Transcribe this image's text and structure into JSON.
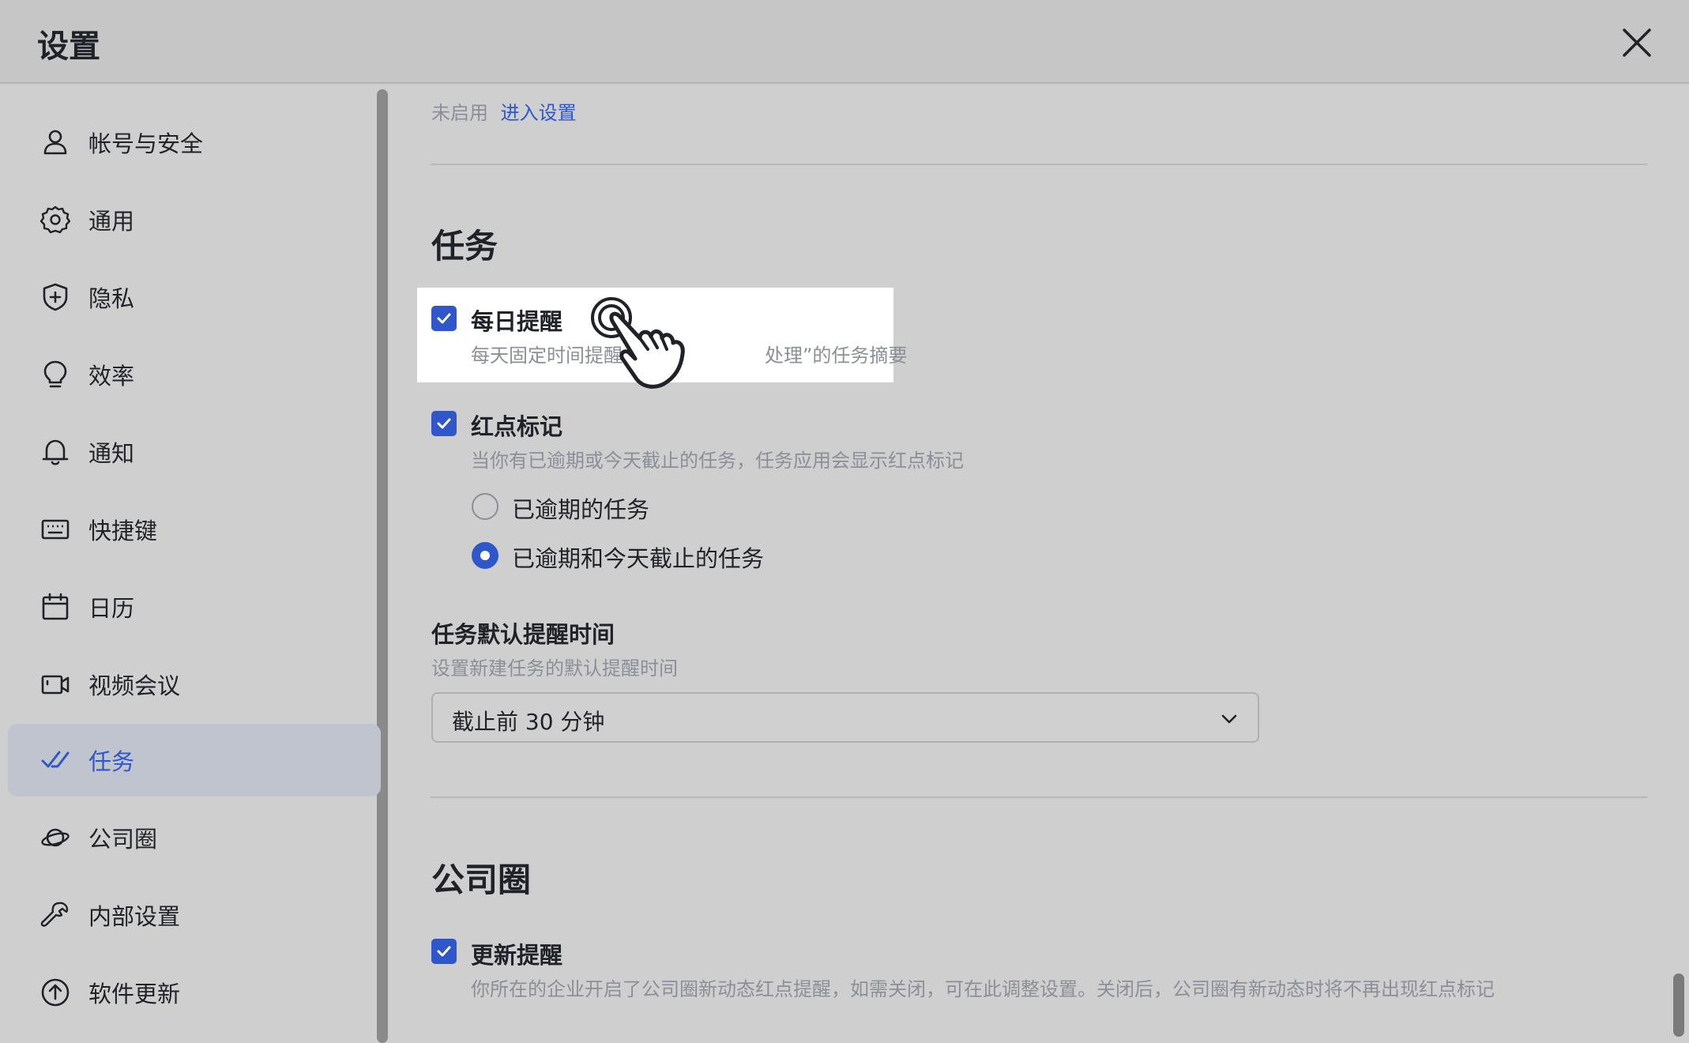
{
  "window": {
    "title": "设置",
    "close_icon": "close-icon"
  },
  "sidebar": {
    "items": [
      {
        "label": "帐号与安全",
        "icon": "user-icon"
      },
      {
        "label": "通用",
        "icon": "gear-icon"
      },
      {
        "label": "隐私",
        "icon": "shield-icon"
      },
      {
        "label": "效率",
        "icon": "lightbulb-icon"
      },
      {
        "label": "通知",
        "icon": "bell-icon"
      },
      {
        "label": "快捷键",
        "icon": "keyboard-icon"
      },
      {
        "label": "日历",
        "icon": "calendar-icon"
      },
      {
        "label": "视频会议",
        "icon": "video-icon"
      },
      {
        "label": "任务",
        "icon": "task-check-icon",
        "active": true
      },
      {
        "label": "公司圈",
        "icon": "planet-icon"
      },
      {
        "label": "内部设置",
        "icon": "wrench-icon"
      },
      {
        "label": "软件更新",
        "icon": "upload-circle-icon"
      }
    ]
  },
  "content": {
    "top_status": "未启用",
    "top_link": "进入设置",
    "task_section": {
      "title": "任务",
      "daily_reminder": {
        "label": "每日提醒",
        "desc_before": "每天固定时间提醒",
        "desc_after": "处理”的任务摘要",
        "checked": true
      },
      "red_dot": {
        "label": "红点标记",
        "desc": "当你有已逾期或今天截止的任务，任务应用会显示红点标记",
        "checked": true,
        "options": [
          {
            "label": "已逾期的任务",
            "selected": false
          },
          {
            "label": "已逾期和今天截止的任务",
            "selected": true
          }
        ]
      },
      "default_time": {
        "label": "任务默认提醒时间",
        "desc": "设置新建任务的默认提醒时间",
        "selected_value": "截止前 30 分钟"
      }
    },
    "moments_section": {
      "title": "公司圈",
      "update_reminder": {
        "label": "更新提醒",
        "desc": "你所在的企业开启了公司圈新动态红点提醒，如需关闭，可在此调整设置。关闭后，公司圈有新动态时将不再出现红点标记",
        "checked": true
      }
    }
  },
  "colors": {
    "accent": "#2f57c9",
    "muted_text": "#8a8f99",
    "active_item_bg": "#c0c4cf"
  }
}
